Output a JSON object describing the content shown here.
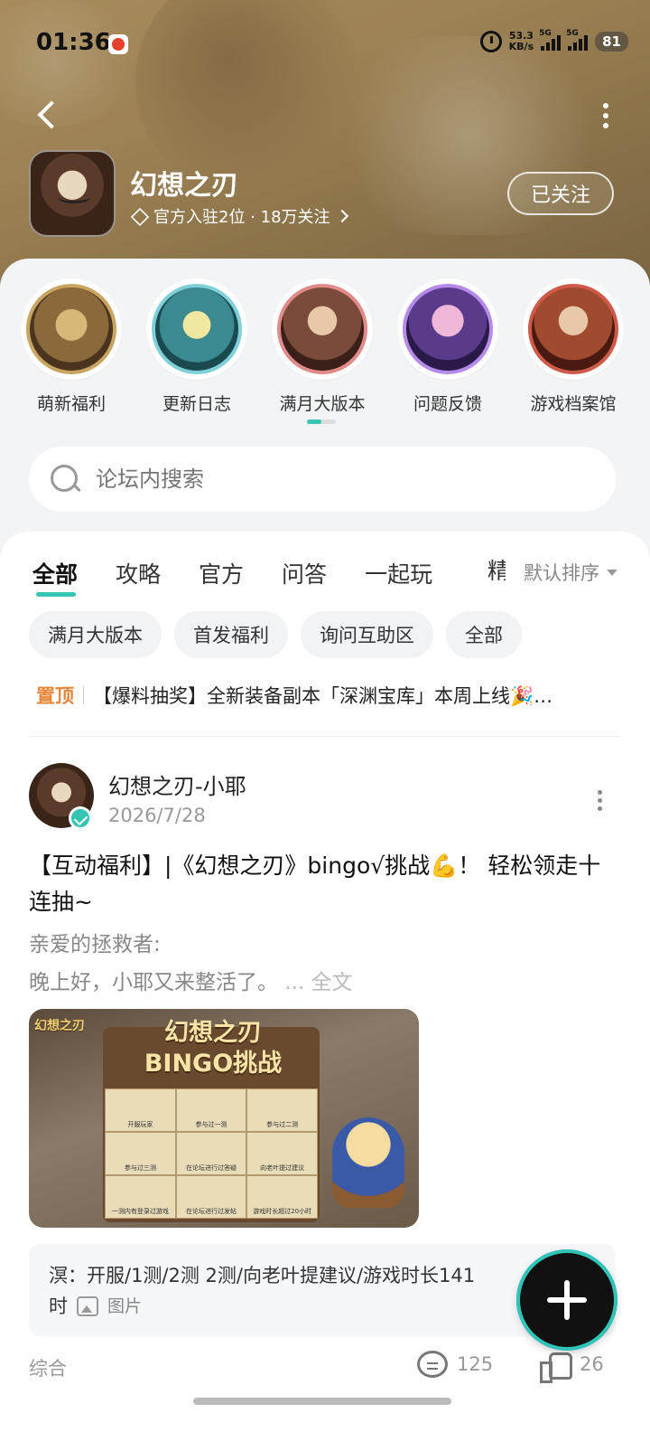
{
  "status": {
    "time": "01:36",
    "net_speed_value": "53.3",
    "net_speed_unit": "KB/s",
    "sig1_label": "5G",
    "sig2_label": "5G",
    "battery": "81"
  },
  "forum": {
    "name": "幻想之刃",
    "meta_text": "官方入驻2位 · 18万关注",
    "follow_label": "已关注"
  },
  "quick_links": [
    {
      "label": "萌新福利",
      "ring": "#c9a561",
      "fill": "#8a6a3a"
    },
    {
      "label": "更新日志",
      "ring": "#7fd0d8",
      "fill": "#3a8a90"
    },
    {
      "label": "满月大版本",
      "ring": "#e08a8a",
      "fill": "#7a4a3a"
    },
    {
      "label": "问题反馈",
      "ring": "#b58ae8",
      "fill": "#5a3a8a"
    },
    {
      "label": "游戏档案馆",
      "ring": "#d05a4a",
      "fill": "#6a2a20"
    }
  ],
  "search": {
    "placeholder": "论坛内搜索"
  },
  "tabs": [
    "全部",
    "攻略",
    "官方",
    "问答",
    "一起玩"
  ],
  "tab_clipped": "精",
  "sort_label": "默认排序",
  "chips": [
    "满月大版本",
    "首发福利",
    "询问互助区",
    "全部"
  ],
  "pinned": {
    "tag": "置顶",
    "text": "【爆料抽奖】全新装备副本「深渊宝库」本周上线🎉…"
  },
  "post": {
    "author": "幻想之刃-小耶",
    "date": "2026/7/28",
    "title": "【互动福利】|《幻想之刃》bingo√挑战💪！ 轻松领走十连抽~",
    "body_line1": "亲爱的拯救者:",
    "body_line2": "晚上好，小耶又来整活了。",
    "read_more": "... 全文",
    "image": {
      "logo": "幻想之刃",
      "title_line1": "幻想之刃",
      "title_line2": "BINGO挑战",
      "cells": [
        "开服玩家",
        "参与过一测",
        "参与过二测",
        "参与过三测",
        "在论坛进行过答疑",
        "向老叶提过建议",
        "一测内有登录过游戏",
        "在论坛进行过发帖",
        "游戏时长超过20小时"
      ]
    },
    "reply_line1": "溟：开服/1测/2测  2测/向老叶提建议/游戏时长141",
    "reply_line2": "时",
    "reply_image_tag": "图片",
    "category": "综合",
    "comments": "125",
    "likes": "26"
  }
}
